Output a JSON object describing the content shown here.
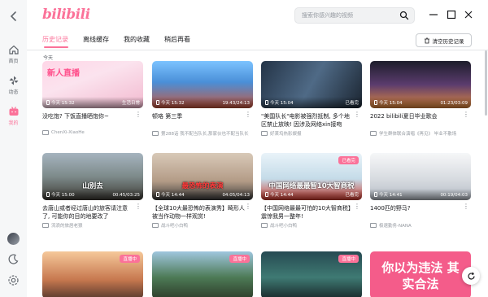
{
  "app": {
    "logo_text": "bilibili",
    "accent_color": "#fb7299"
  },
  "rail": {
    "back_icon": "chevron-left-icon",
    "items": [
      {
        "label": "首页",
        "icon": "home-icon",
        "active": false
      },
      {
        "label": "动态",
        "icon": "windmill-icon",
        "active": false
      },
      {
        "label": "我的",
        "icon": "tv-icon",
        "active": true
      }
    ]
  },
  "search": {
    "placeholder": "搜索你感兴趣的视频"
  },
  "tabs": [
    {
      "label": "历史记录",
      "active": true
    },
    {
      "label": "离线缓存",
      "active": false
    },
    {
      "label": "我的收藏",
      "active": false
    },
    {
      "label": "稍后再看",
      "active": false
    }
  ],
  "toolbar": {
    "clear_label": "清空历史记录"
  },
  "section": {
    "label": "今天"
  },
  "cards": [
    {
      "title": "没吃饱? 下饭直播晒饱你~",
      "author": "ChenXi-XiaoHe",
      "when": "今天 15:32",
      "duration": "生活日常",
      "thumb_text": "新人直播",
      "badge": "",
      "art": "t-anime1"
    },
    {
      "title": "顿珞 第三季",
      "author": "第288话 我不配当队长,那家伙也不配当队长",
      "when": "今天 15:32",
      "duration": "19:43/24:13",
      "thumb_text": "",
      "badge": "",
      "art": "t-anime2"
    },
    {
      "title": "\"美国队长\"电影被强烈抵制, 多个地区禁止放映! 因涉及网络xin接吻",
      "author": "好莱坞热影娱报",
      "when": "今天 15:04",
      "duration": "已看完",
      "thumb_text": "",
      "badge": "",
      "art": "t-cap"
    },
    {
      "title": "2022 bilibili夏日毕业歌会",
      "author": "学生群体联合演唱《再见》 毕业不散场",
      "when": "今天 15:04",
      "duration": "01:23/03:09",
      "thumb_text": "",
      "badge": "",
      "art": "t-dance"
    },
    {
      "title": "去唐山或者经过唐山的旅客请注意了, 可能你的目的地要改了",
      "author": "流浪的旅居老狼",
      "when": "今天 15:00",
      "duration": "00:45/03:25",
      "thumb_text": "山别去",
      "badge": "",
      "art": "t-street"
    },
    {
      "title": "【全球10大最恐怖的表演秀】畸形人被当作动物一样观赏!",
      "author": "战斗吧小白鸭",
      "when": "今天 14:44",
      "duration": "04:05/04:13",
      "thumb_text": "最恐怖的表演",
      "badge": "",
      "art": "t-face"
    },
    {
      "title": "【中国网络最最可怕的10大智商税】震惊我男一整年!",
      "author": "战斗吧小白鸭",
      "when": "今天 14:44",
      "duration": "已看完",
      "thumb_text": "中国网络最最智10大智商税",
      "badge": "已看完",
      "art": "t-meme"
    },
    {
      "title": "1400匹的野马?",
      "author": "极速勤务-NANA",
      "when": "今天 14:41",
      "duration": "00:19/04:03",
      "thumb_text": "",
      "badge": "",
      "art": "t-car"
    },
    {
      "title": "",
      "author": "",
      "when": "",
      "duration": "",
      "thumb_text": "",
      "badge": "直播中",
      "art": "t-balloon"
    },
    {
      "title": "",
      "author": "",
      "when": "",
      "duration": "",
      "thumb_text": "",
      "badge": "直播中",
      "art": "t-game"
    },
    {
      "title": "",
      "author": "",
      "when": "",
      "duration": "",
      "thumb_text": "",
      "badge": "直播中",
      "art": "t-fairy"
    },
    {
      "title": "",
      "author": "",
      "when": "",
      "duration": "",
      "thumb_text": "你以为违法 其实合法",
      "badge": "",
      "art": "t-law"
    }
  ]
}
